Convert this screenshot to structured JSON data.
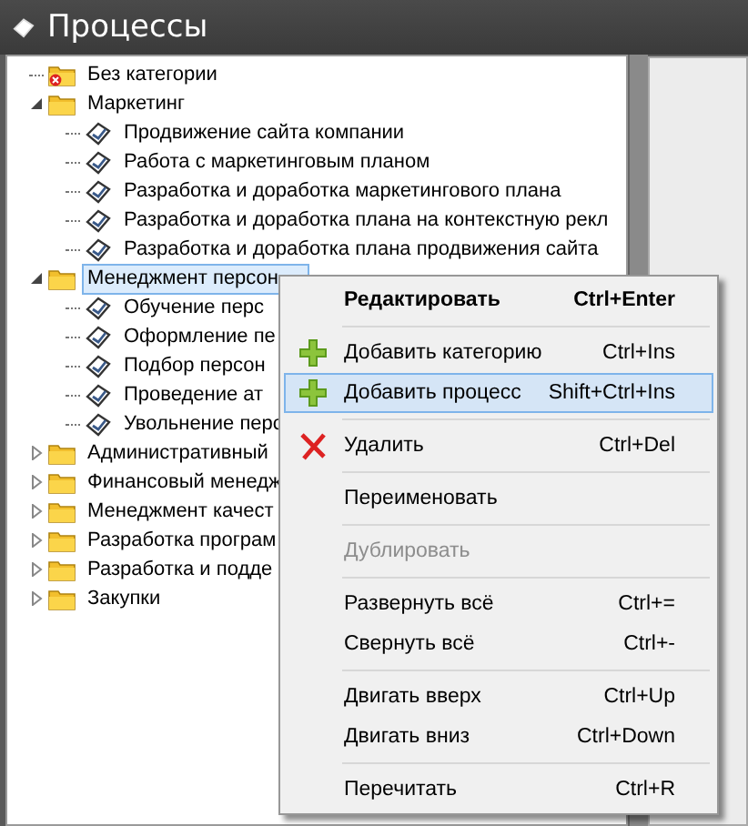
{
  "window": {
    "title": "Процессы"
  },
  "tree": [
    {
      "label": "Без категории",
      "kind": "uncategorized",
      "selected": false
    },
    {
      "label": "Маркетинг",
      "kind": "folder",
      "selected": false,
      "expanded": true,
      "children": [
        {
          "label": "Продвижение сайта компании",
          "kind": "process",
          "selected": false
        },
        {
          "label": "Работа с маркетинговым планом",
          "kind": "process",
          "selected": false
        },
        {
          "label": "Разработка и доработка маркетингового плана",
          "kind": "process",
          "selected": false
        },
        {
          "label": "Разработка и доработка плана на контекстную рекл",
          "kind": "process",
          "selected": false
        },
        {
          "label": "Разработка и доработка плана продвижения сайта",
          "kind": "process",
          "selected": false
        }
      ]
    },
    {
      "label": "Менеджмент персон",
      "kind": "folder",
      "selected": true,
      "expanded": true,
      "children": [
        {
          "label": "Обучение перс",
          "kind": "process",
          "selected": false
        },
        {
          "label": "Оформление пе",
          "kind": "process",
          "selected": false
        },
        {
          "label": "Подбор персон",
          "kind": "process",
          "selected": false
        },
        {
          "label": "Проведение ат",
          "kind": "process",
          "selected": false
        },
        {
          "label": "Увольнение перс",
          "kind": "process",
          "selected": false
        }
      ]
    },
    {
      "label": "Административный",
      "kind": "folder",
      "selected": false,
      "expanded": false
    },
    {
      "label": "Финансовый менедж",
      "kind": "folder",
      "selected": false,
      "expanded": false
    },
    {
      "label": "Менеджмент качест",
      "kind": "folder",
      "selected": false,
      "expanded": false
    },
    {
      "label": "Разработка програм",
      "kind": "folder",
      "selected": false,
      "expanded": false
    },
    {
      "label": "Разработка и подде",
      "kind": "folder",
      "selected": false,
      "expanded": false
    },
    {
      "label": "Закупки",
      "kind": "folder",
      "selected": false,
      "expanded": false
    }
  ],
  "context_menu": [
    {
      "kind": "item",
      "label": "Редактировать",
      "shortcut": "Ctrl+Enter",
      "bold": true,
      "selected": false,
      "disabled": false
    },
    {
      "kind": "separator"
    },
    {
      "kind": "add",
      "label": "Добавить категорию",
      "shortcut": "Ctrl+Ins",
      "selected": false,
      "disabled": false
    },
    {
      "kind": "add",
      "label": "Добавить процесс",
      "shortcut": "Shift+Ctrl+Ins",
      "selected": true,
      "disabled": false
    },
    {
      "kind": "separator"
    },
    {
      "kind": "delete",
      "label": "Удалить",
      "shortcut": "Ctrl+Del",
      "selected": false,
      "disabled": false
    },
    {
      "kind": "separator"
    },
    {
      "kind": "item",
      "label": "Переименовать",
      "selected": false,
      "disabled": false
    },
    {
      "kind": "separator"
    },
    {
      "kind": "item",
      "label": "Дублировать",
      "selected": false,
      "disabled": true
    },
    {
      "kind": "separator"
    },
    {
      "kind": "item",
      "label": "Развернуть всё",
      "shortcut": "Ctrl+=",
      "selected": false,
      "disabled": false
    },
    {
      "kind": "item",
      "label": "Свернуть всё",
      "shortcut": "Ctrl+-",
      "selected": false,
      "disabled": false
    },
    {
      "kind": "separator"
    },
    {
      "kind": "item",
      "label": "Двигать вверх",
      "shortcut": "Ctrl+Up",
      "selected": false,
      "disabled": false
    },
    {
      "kind": "item",
      "label": "Двигать вниз",
      "shortcut": "Ctrl+Down",
      "selected": false,
      "disabled": false
    },
    {
      "kind": "separator"
    },
    {
      "kind": "item",
      "label": "Перечитать",
      "shortcut": "Ctrl+R",
      "selected": false,
      "disabled": false
    }
  ]
}
